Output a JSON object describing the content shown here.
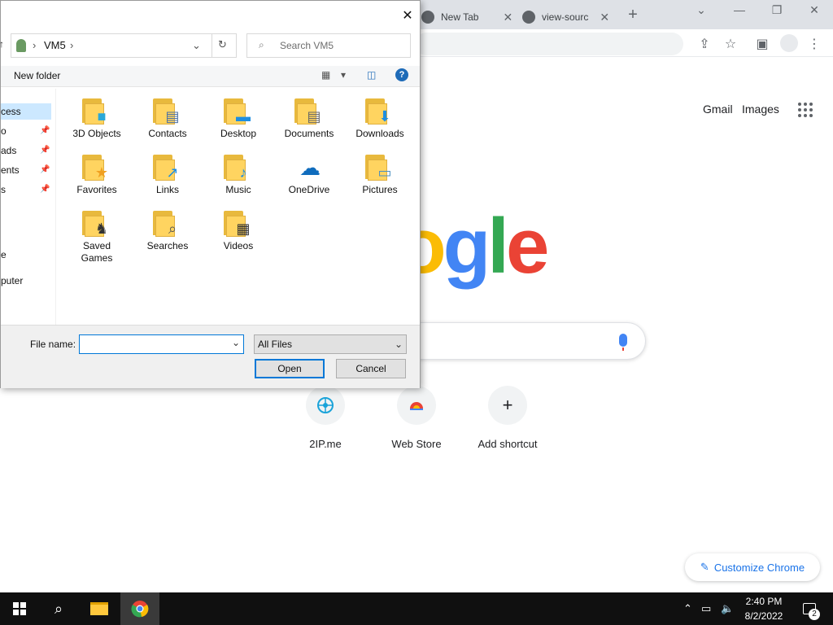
{
  "browser": {
    "tabs": [
      {
        "title": "New Tab"
      },
      {
        "title": "view-sourc"
      }
    ],
    "ntp": {
      "gmail": "Gmail",
      "images": "Images",
      "shortcuts": [
        {
          "label": "2IP.me"
        },
        {
          "label": "Web Store"
        },
        {
          "label": "Add shortcut",
          "icon": "+"
        }
      ],
      "customize": "Customize Chrome"
    }
  },
  "dialog": {
    "breadcrumb": "VM5",
    "search_placeholder": "Search VM5",
    "new_folder": "New folder",
    "nav": [
      "cess",
      "o",
      "ads",
      "ents",
      "s",
      "e",
      "puter"
    ],
    "items": [
      "3D Objects",
      "Contacts",
      "Desktop",
      "Documents",
      "Downloads",
      "Favorites",
      "Links",
      "Music",
      "OneDrive",
      "Pictures",
      "Saved Games",
      "Searches",
      "Videos"
    ],
    "file_name_label": "File name:",
    "file_name_value": "",
    "filter": "All Files",
    "open": "Open",
    "cancel": "Cancel"
  },
  "taskbar": {
    "time": "2:40 PM",
    "date": "8/2/2022",
    "notifications": "2"
  }
}
